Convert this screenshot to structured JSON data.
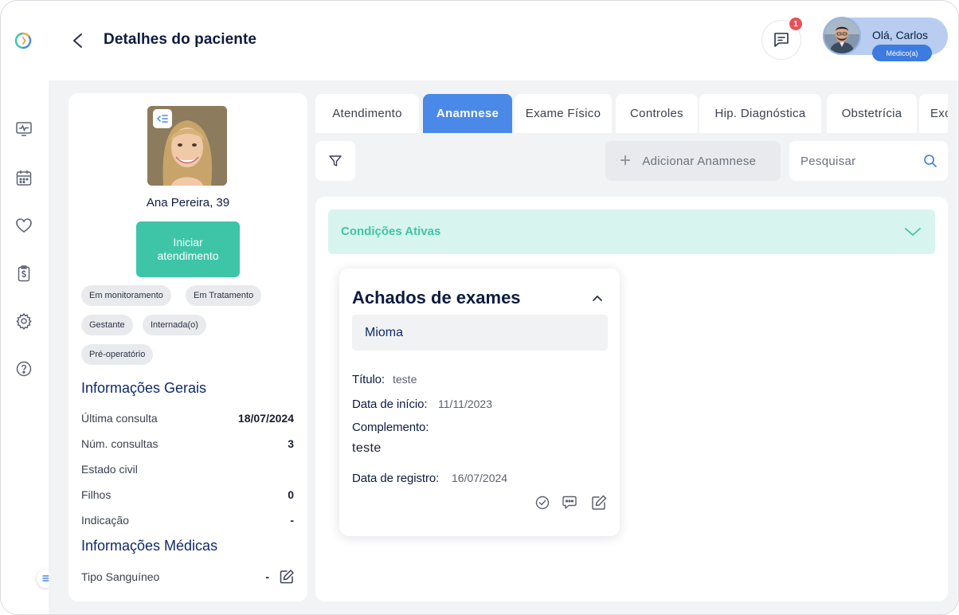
{
  "header": {
    "title": "Detalhes do paciente",
    "notification_count": "1",
    "user_greeting": "Olá, Carlos",
    "user_role": "Médico(a)"
  },
  "rail": {
    "items": [
      "monitor-icon",
      "calendar-icon",
      "heart-icon",
      "clipboard-dollar-icon",
      "gear-icon",
      "help-icon"
    ]
  },
  "patient": {
    "name": "Ana Pereira, 39",
    "start_button": "Iniciar atendimento",
    "tags": [
      "Em monitoramento",
      "Em Tratamento",
      "Gestante",
      "Internada(o)",
      "Pré-operatório"
    ],
    "general_title": "Informações Gerais",
    "general": [
      {
        "label": "Última consulta",
        "value": "18/07/2024"
      },
      {
        "label": "Núm. consultas",
        "value": "3"
      },
      {
        "label": "Estado civil",
        "value": ""
      },
      {
        "label": "Filhos",
        "value": "0"
      },
      {
        "label": "Indicação",
        "value": "-"
      }
    ],
    "medical_title": "Informações Médicas",
    "medical": [
      {
        "label": "Tipo Sanguíneo",
        "value": "-"
      }
    ]
  },
  "tabs": [
    {
      "label": "Atendimento",
      "active": false
    },
    {
      "label": "Anamnese",
      "active": true
    },
    {
      "label": "Exame Físico",
      "active": false
    },
    {
      "label": "Controles",
      "active": false
    },
    {
      "label": "Hip. Diagnóstica",
      "active": false
    },
    {
      "label": "Obstetrícia",
      "active": false
    },
    {
      "label": "Exc",
      "active": false
    }
  ],
  "toolbar": {
    "add_label": "Adicionar Anamnese",
    "search_placeholder": "Pesquisar"
  },
  "panel": {
    "accordion_title": "Condições Ativas",
    "card": {
      "title": "Achados de exames",
      "diagnosis": "Mioma",
      "titulo_label": "Título:",
      "titulo_value": "teste",
      "inicio_label": "Data de início:",
      "inicio_value": "11/11/2023",
      "complemento_label": "Complemento:",
      "complemento_value": "teste",
      "registro_label": "Data de registro:",
      "registro_value": "16/07/2024"
    }
  },
  "colors": {
    "primary": "#4a89e8",
    "accent": "#3ec5a8",
    "accent_light": "#d8f4ee",
    "badge": "#e8515a"
  }
}
